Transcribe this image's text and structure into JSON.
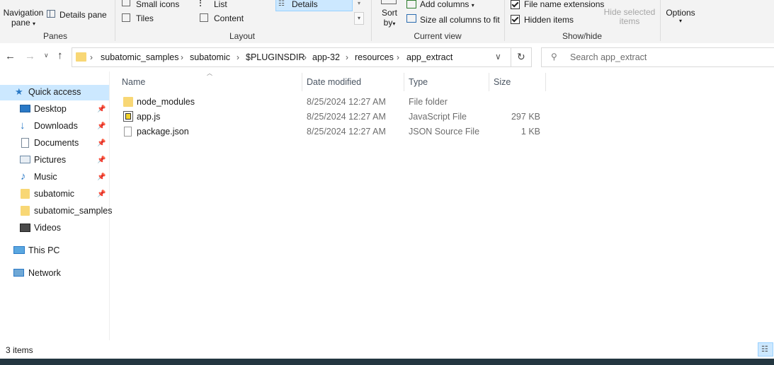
{
  "ribbon": {
    "panes": {
      "navigation_pane": "Navigation",
      "navigation_pane_sub": "pane",
      "details_pane": "Details pane",
      "group_label": "Panes"
    },
    "layout": {
      "small_icons": "Small icons",
      "list": "List",
      "details": "Details",
      "tiles": "Tiles",
      "content": "Content",
      "group_label": "Layout"
    },
    "current_view": {
      "sort": "Sort",
      "sort_sub": "by",
      "add_columns": "Add columns",
      "size_all_columns": "Size all columns to fit",
      "group_label": "Current view"
    },
    "show_hide": {
      "file_name_extensions": "File name extensions",
      "hidden_items": "Hidden items",
      "hide_selected_line1": "Hide selected",
      "hide_selected_line2": "items",
      "group_label": "Show/hide"
    },
    "options": "Options"
  },
  "address": {
    "breadcrumbs": [
      "subatomic_samples",
      "subatomic",
      "$PLUGINSDIR",
      "app-32",
      "resources",
      "app_extract"
    ],
    "search_placeholder": "Search app_extract"
  },
  "nav": {
    "quick_access": "Quick access",
    "items": [
      {
        "label": "Desktop",
        "icon": "desktop-icon",
        "pinned": true
      },
      {
        "label": "Downloads",
        "icon": "download-icon",
        "pinned": true
      },
      {
        "label": "Documents",
        "icon": "document-icon",
        "pinned": true
      },
      {
        "label": "Pictures",
        "icon": "picture-icon",
        "pinned": true
      },
      {
        "label": "Music",
        "icon": "music-icon",
        "pinned": true
      },
      {
        "label": "subatomic",
        "icon": "folder-icon",
        "pinned": true
      },
      {
        "label": "subatomic_samples",
        "icon": "folder-icon",
        "pinned": false
      },
      {
        "label": "Videos",
        "icon": "video-icon",
        "pinned": false
      }
    ],
    "this_pc": "This PC",
    "network": "Network"
  },
  "columns": {
    "name": "Name",
    "date": "Date modified",
    "type": "Type",
    "size": "Size"
  },
  "files": [
    {
      "name": "node_modules",
      "date": "8/25/2024 12:27 AM",
      "type": "File folder",
      "size": "",
      "icon": "folder-icon"
    },
    {
      "name": "app.js",
      "date": "8/25/2024 12:27 AM",
      "type": "JavaScript File",
      "size": "297 KB",
      "icon": "js-file-icon"
    },
    {
      "name": "package.json",
      "date": "8/25/2024 12:27 AM",
      "type": "JSON Source File",
      "size": "1 KB",
      "icon": "json-file-icon"
    }
  ],
  "status": {
    "item_count": "3 items"
  },
  "colors": {
    "accent": "#0067c0",
    "folder": "#f8d775",
    "selected_bg": "#cce8ff",
    "hover_bg": "#e5f3ff"
  }
}
